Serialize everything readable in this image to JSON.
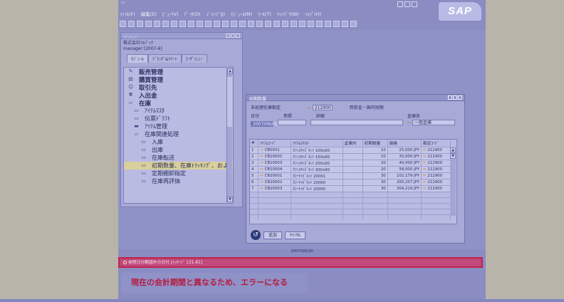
{
  "window": {
    "menu": [
      "ﾌｧｲﾙ(F)",
      "編集(E)",
      "ﾋﾞｭｰ(V)",
      "ﾃﾞｰﾀ(D)",
      "ｼﾞｬﾝﾌﾟ(J)",
      "ﾓｼﾞｭｰﾙ(M)",
      "ﾂｰﾙ(T)",
      "ｳｨﾝﾄﾞｳ(W)",
      "ﾍﾙﾌﾟ(H)"
    ],
    "logo": "SAP"
  },
  "sidebar": {
    "title": "ﾒｲﾝﾒﾆｭｰ",
    "company": "株式会社ｿﾙﾊﾞｯｸ",
    "user": "manager [2007-6]",
    "tabs": [
      "ﾓｼﾞｭｰﾙ",
      "ﾄﾞﾗｯｸﾞ&ﾘﾘｰﾄ",
      "ﾕｰｻﾞﾒﾆｭｰ"
    ],
    "items": [
      {
        "label": "販売管理",
        "icon": "sales-icon"
      },
      {
        "label": "購買管理",
        "icon": "purchasing-icon"
      },
      {
        "label": "取引先",
        "icon": "partners-icon"
      },
      {
        "label": "入出金",
        "icon": "banking-icon"
      },
      {
        "label": "在庫",
        "icon": "folder-open-icon"
      },
      {
        "label": "ｱｲﾃﾑﾏｽﾀ",
        "icon": "form-icon"
      },
      {
        "label": "伝票ﾄﾞﾗﾌﾄ",
        "icon": "form-icon"
      },
      {
        "label": "ｱｲﾃﾑ管理",
        "icon": "folder-icon"
      },
      {
        "label": "在庫関連処理",
        "icon": "folder-open-icon"
      },
      {
        "label": "入庫",
        "icon": "form-icon"
      },
      {
        "label": "出庫",
        "icon": "form-icon"
      },
      {
        "label": "在庫転送",
        "icon": "form-icon"
      },
      {
        "label": "初期数量、在庫ﾄﾗｯｷﾝｸﾞ、およ",
        "icon": "form-icon"
      },
      {
        "label": "定期棚卸指定",
        "icon": "form-icon"
      },
      {
        "label": "在庫再評価",
        "icon": "form-icon"
      }
    ]
  },
  "dialog": {
    "title": "初期数量",
    "unprocessed_label": "未処理在庫勘定",
    "account": "212900",
    "account_name": "買掛金－国内短期",
    "date_label": "日付",
    "ref_label": "参照",
    "remarks_label": "詳細",
    "warehouse_label": "倉庫名",
    "date_value": "2007/06/01",
    "warehouse_value": "一般倉庫",
    "columns": [
      "#",
      "ｱｲﾃﾑｺｰﾄﾞ",
      "ｱｲﾃﾑﾃｷｽﾄ",
      "倉庫内",
      "初期数量",
      "価格",
      "勘定ｺｰﾄﾞ"
    ],
    "rows": [
      [
        "1",
        "CB0001",
        "ｵﾌｨｽｷｬﾋﾞﾈｯﾄ 100x90",
        "",
        "10",
        "25,000 JPY",
        "212900"
      ],
      [
        "2",
        "CB10002",
        "ｵﾌｨｽｷｬﾋﾞﾈｯﾄ 150x90",
        "",
        "10",
        "35,000 JPY",
        "212900"
      ],
      [
        "3",
        "CB10003",
        "ｵﾌｨｽｷｬﾋﾞﾈｯﾄ 200x90",
        "",
        "20",
        "40,000 JPY",
        "212900"
      ],
      [
        "4",
        "CB10004",
        "ｵﾌｨｽｷｬﾋﾞﾈｯﾄ 300x90",
        "",
        "20",
        "58,000 JPY",
        "212900"
      ],
      [
        "5",
        "CB20001",
        "ｶﾗｰｷｬﾋﾞﾈｯﾄ 20001",
        "",
        "30",
        "102,179 JPY",
        "212900"
      ],
      [
        "6",
        "CB20002",
        "ｶﾗｰｷｬﾋﾞﾈｯﾄ 20000",
        "",
        "30",
        "200,207 JPY",
        "212900"
      ],
      [
        "7",
        "CB20003",
        "ｶﾗｰｷｬﾋﾞﾈｯﾄ 20000",
        "",
        "30",
        "304,219 JPY",
        "212900"
      ]
    ],
    "empty_rows": 5,
    "buttons": {
      "add": "追加",
      "cancel": "ｷｬﾝｾﾙ"
    }
  },
  "footer": {
    "date": "2007/06/20",
    "status_message": "参照日付範囲外の日付 [ﾒｯｾｰｼﾞ 131-81]",
    "callout": "現在の会計期間と異なるため、エラーになる"
  },
  "colors": {
    "error_border": "#c4224a",
    "callout_text": "#b81a3e",
    "app_bg": "#8a8cc2"
  }
}
